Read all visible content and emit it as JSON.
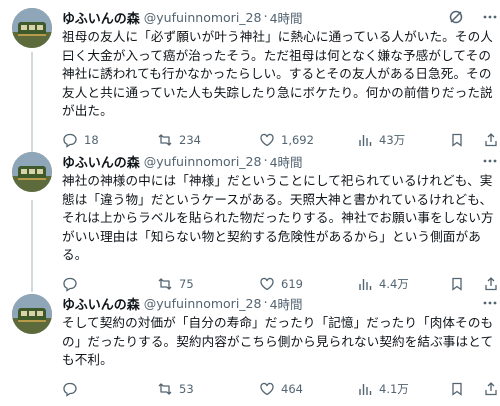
{
  "tweets": [
    {
      "name": "ゆふいんの森",
      "handle": "@yufuinnomori_28",
      "separator": "·",
      "time": "4時間",
      "text": "祖母の友人に「必ず願いが叶う神社」に熱心に通っている人がいた。その人曰く大金が入って癌が治ったそう。ただ祖母は何となく嫌な予感がしてその神社に誘われても行かなかったらしい。するとその友人がある日急死。その友人と共に通っていた人も失踪したり急にボケたり。何かの前借りだった説が出た。",
      "replies": "18",
      "retweets": "234",
      "likes": "1,692",
      "views": "43万"
    },
    {
      "name": "ゆふいんの森",
      "handle": "@yufuinnomori_28",
      "separator": "·",
      "time": "4時間",
      "text": "神社の神様の中には「神様」だということにして祀られているけれども、実態は「違う物」だというケースがある。天照大神と書かれているけれども、それは上からラベルを貼られた物だったりする。神社でお願い事をしない方がいい理由は「知らない物と契約する危険性があるから」という側面がある。",
      "replies": "",
      "retweets": "75",
      "likes": "619",
      "views": "4.4万"
    },
    {
      "name": "ゆふいんの森",
      "handle": "@yufuinnomori_28",
      "separator": "·",
      "time": "4時間",
      "text": "そして契約の対価が「自分の寿命」だったり「記憶」だったり「肉体そのもの」だったりする。契約内容がこちら側から見られない契約を結ぶ事はとても不利。",
      "replies": "",
      "retweets": "53",
      "likes": "464",
      "views": "4.1万"
    }
  ],
  "icons": {
    "grok": "grok-slash-icon",
    "more": "more-dots-icon",
    "reply": "reply-bubble-icon",
    "retweet": "retweet-icon",
    "like": "heart-icon",
    "views": "views-bar-chart-icon",
    "bookmark": "bookmark-icon",
    "share": "share-upload-icon"
  },
  "colors": {
    "text": "#0f1419",
    "secondary": "#536471",
    "thread_line": "#cfd9de"
  }
}
